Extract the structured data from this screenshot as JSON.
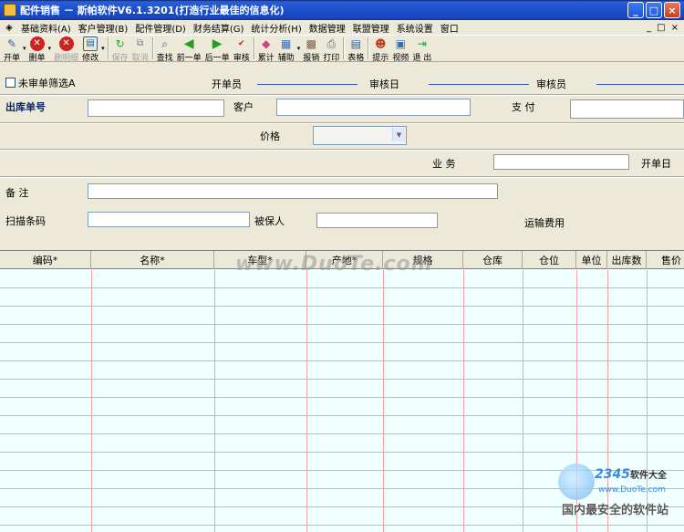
{
  "window": {
    "title": "配件销售 － 斯帕软件V6.1.3201(打造行业最佳的信息化)",
    "controls": [
      "_",
      "□",
      "×"
    ]
  },
  "menu": {
    "items": [
      "基础资料(A)",
      "客户管理(B)",
      "配件管理(D)",
      "财务结算(G)",
      "统计分析(H)",
      "数据管理",
      "联盟管理",
      "系统设置",
      "窗口"
    ],
    "mdi_controls": [
      "_",
      "□",
      "×"
    ]
  },
  "toolbar": {
    "buttons": [
      {
        "label": "开单",
        "icon": "pencil-icon",
        "color": "#3060C0",
        "disabled": false
      },
      {
        "label": "删单",
        "icon": "delete-icon",
        "color": "#D02020",
        "disabled": false
      },
      {
        "label": "删明细",
        "icon": "delete-detail-icon",
        "color": "#D02020",
        "disabled": true
      },
      {
        "label": "修改",
        "icon": "edit-icon",
        "color": "#2060B0",
        "disabled": false
      },
      {
        "label": "保存",
        "icon": "save-icon",
        "color": "#30A030",
        "disabled": true
      },
      {
        "label": "取消",
        "icon": "cancel-icon",
        "color": "#6080B0",
        "disabled": true
      },
      {
        "label": "查找",
        "icon": "find-icon",
        "color": "#405080",
        "disabled": false
      },
      {
        "label": "前一单",
        "icon": "prev-icon",
        "color": "#20A020",
        "disabled": false
      },
      {
        "label": "后一单",
        "icon": "next-icon",
        "color": "#20A020",
        "disabled": false
      },
      {
        "label": "审核",
        "icon": "audit-icon",
        "color": "#C02020",
        "disabled": false
      },
      {
        "label": "累计",
        "icon": "accumulate-icon",
        "color": "#D04080",
        "disabled": false
      },
      {
        "label": "辅助",
        "icon": "assist-icon",
        "color": "#3070C0",
        "disabled": false
      },
      {
        "label": "报销",
        "icon": "reimburse-icon",
        "color": "#806040",
        "disabled": false
      },
      {
        "label": "打印",
        "icon": "print-icon",
        "color": "#606060",
        "disabled": false
      },
      {
        "label": "表格",
        "icon": "table-icon",
        "color": "#3060A0",
        "disabled": false
      },
      {
        "label": "提示",
        "icon": "tip-icon",
        "color": "#C04020",
        "disabled": false
      },
      {
        "label": "视频",
        "icon": "video-icon",
        "color": "#3070B0",
        "disabled": false
      },
      {
        "label": "退 出",
        "icon": "exit-icon",
        "color": "#20A040",
        "disabled": false
      }
    ]
  },
  "form": {
    "unaudited_filter_label": "未审单筛选A",
    "issuer_label": "开单员",
    "audit_date_label": "审核日",
    "auditor_label": "审核员",
    "outbound_no_label": "出库单号",
    "outbound_no_value": "",
    "customer_label": "客户",
    "customer_value": "",
    "payment_label": "支 付",
    "payment_value": "",
    "price_label": "价格",
    "price_value": "",
    "business_label": "业 务",
    "business_value": "",
    "issue_date_label": "开单日",
    "remark_label": "备 注",
    "remark_value": "",
    "barcode_label": "扫描条码",
    "barcode_value": "",
    "insured_label": "被保人",
    "insured_value": "",
    "shipping_label": "运输费用"
  },
  "grid": {
    "columns": [
      "编码*",
      "名称*",
      "车型*",
      "产地*",
      "规格",
      "仓库",
      "仓位",
      "单位",
      "出库数",
      "售价"
    ],
    "rows": []
  },
  "watermarks": {
    "center": "www.DuoTe.com",
    "brand_number": "2345",
    "brand_text": "软件大全",
    "brand_url": "www.DuoTe.com",
    "slogan": "国内最安全的软件站"
  }
}
